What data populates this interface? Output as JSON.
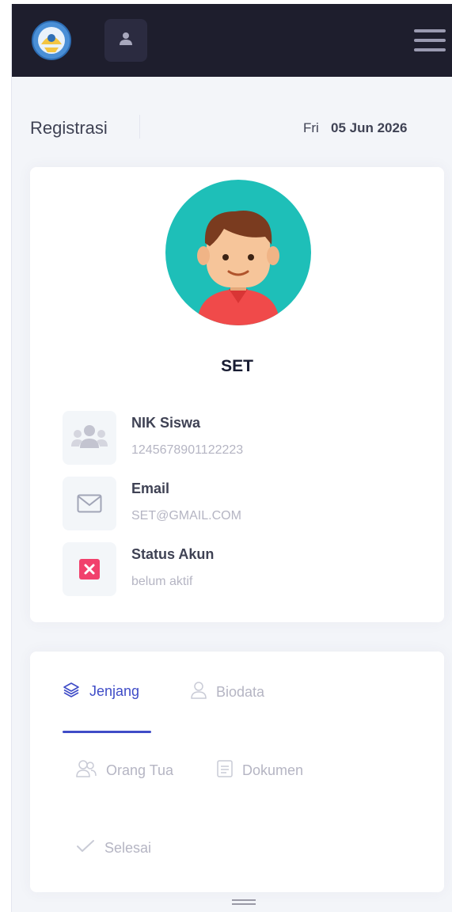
{
  "header": {
    "logo_icon": "tut-wuri-handayani-logo",
    "user_icon": "user-icon",
    "menu_icon": "hamburger-menu-icon"
  },
  "subheader": {
    "title": "Registrasi",
    "date_day": "Fri",
    "date_full": "05 Jun 2026"
  },
  "profile": {
    "avatar_icon": "boy-avatar-icon",
    "name": "SET",
    "items": [
      {
        "label": "NIK Siswa",
        "value": "1245678901122223",
        "icon": "users-icon"
      },
      {
        "label": "Email",
        "value": "SET@GMAIL.COM",
        "icon": "envelope-icon"
      },
      {
        "label": "Status Akun",
        "value": "belum aktif",
        "icon": "close-box-icon",
        "status_color": "#f1416c"
      }
    ]
  },
  "steps": [
    {
      "label": "Jenjang",
      "icon": "layers-icon",
      "active": true
    },
    {
      "label": "Biodata",
      "icon": "user-outline-icon",
      "active": false
    },
    {
      "label": "Orang Tua",
      "icon": "parents-icon",
      "active": false
    },
    {
      "label": "Dokumen",
      "icon": "document-icon",
      "active": false
    },
    {
      "label": "Selesai",
      "icon": "check-icon",
      "active": false
    }
  ],
  "colors": {
    "topbar": "#1e1e2d",
    "accent": "#3f4cc7",
    "avatar_bg": "#1ebfb8",
    "danger": "#f1416c"
  }
}
